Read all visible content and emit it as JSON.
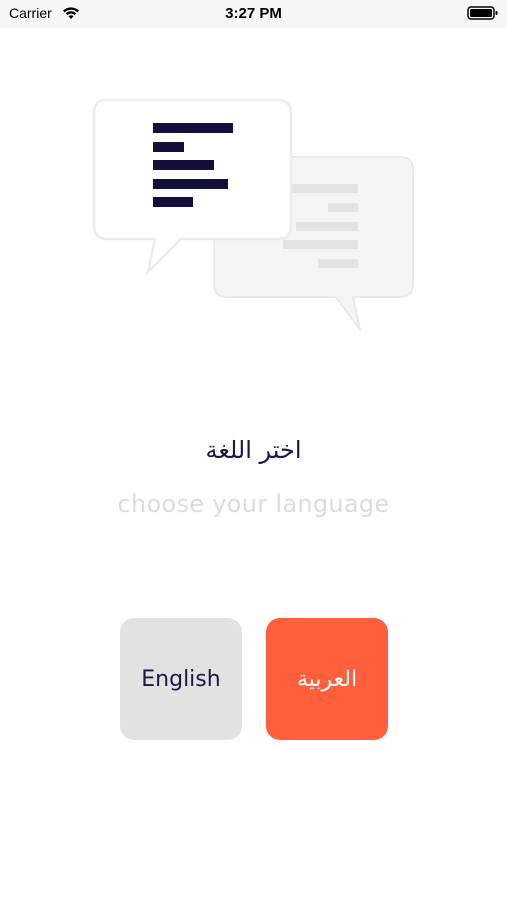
{
  "status_bar": {
    "carrier": "Carrier",
    "time": "3:27 PM"
  },
  "screen": {
    "title_arabic": "اختر اللغة",
    "subtitle_english": "choose your language"
  },
  "buttons": {
    "english_label": "English",
    "arabic_label": "العربية"
  },
  "colors": {
    "navy": "#1b1845",
    "accent_orange": "#ff5f3a",
    "button_gray": "#e2e2e2",
    "muted_text": "#dcdcdc"
  },
  "icons": {
    "status": [
      "wifi-icon",
      "battery-icon"
    ],
    "illustration": [
      "chat-bubble-front-icon",
      "chat-bubble-back-icon"
    ]
  }
}
